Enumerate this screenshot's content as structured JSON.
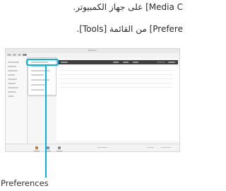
{
  "instructions": {
    "line1": "Media C] على جهاز الكمبيوتر.",
    "line2": "Prefere] من القائمة [Tools]."
  },
  "screenshot": {
    "window_title": "Media Go"
  },
  "callout": {
    "label": "Preferences",
    "color": "#00b4e3"
  }
}
